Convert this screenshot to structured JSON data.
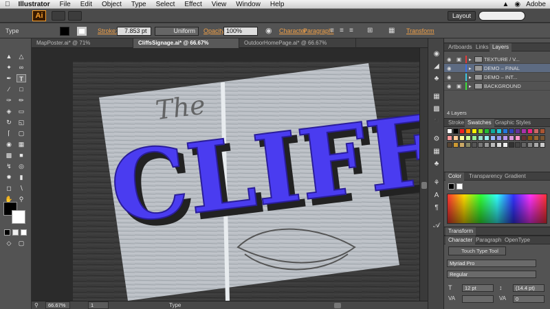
{
  "menubar": {
    "app": "Illustrator",
    "items": [
      "File",
      "Edit",
      "Object",
      "Type",
      "Select",
      "Effect",
      "View",
      "Window",
      "Help"
    ],
    "right_label": "Adobe"
  },
  "appbar": {
    "logo": "Ai",
    "workspace": "Layout"
  },
  "control": {
    "tool_label": "Type",
    "stroke_label": "Stroke:",
    "stroke_weight": "7.853 pt",
    "stroke_profile": "Uniform",
    "opacity_label": "Opacity:",
    "opacity_value": "100%",
    "character_link": "Character",
    "paragraph_link": "Paragraph:",
    "transform_link": "Transform"
  },
  "tabs": [
    {
      "label": "MapPoster.ai* @ 71% (CMYK/Preview)"
    },
    {
      "label": "CliffsSignage.ai* @ 66.67% (CMYK/Preview)"
    },
    {
      "label": "OutdoorHomePage.ai* @ 66.67% (RGB/Preview)"
    }
  ],
  "artwork": {
    "script_text": "The",
    "headline": "CLIFFS",
    "headline_color": "#4a3cf0"
  },
  "status": {
    "zoom": "66.67%",
    "page": "1",
    "tool": "Type"
  },
  "layers_panel": {
    "tabs": [
      "Artboards",
      "Links",
      "Layers"
    ],
    "layers": [
      {
        "name": "TEXTURE / V...",
        "color": "#e23c3c"
      },
      {
        "name": "DEMO – FINAL",
        "color": "#3c6ee2"
      },
      {
        "name": "DEMO – INT...",
        "color": "#3cc8e2"
      },
      {
        "name": "BACKGROUND",
        "color": "#3ce23c"
      }
    ],
    "count": "4 Layers"
  },
  "swatches_panel": {
    "tabs": [
      "Stroke",
      "Swatches",
      "Graphic Styles"
    ]
  },
  "color_panel": {
    "tabs": [
      "Color",
      "Transparency",
      "Gradient"
    ]
  },
  "transform_panel": {
    "title": "Transform"
  },
  "character_panel": {
    "tabs": [
      "Character",
      "Paragraph",
      "OpenType"
    ],
    "touch_type": "Touch Type Tool",
    "font_family": "Myriad Pro",
    "font_style": "Regular",
    "font_size": "12 pt",
    "leading": "(14.4 pt)",
    "tracking": "0"
  }
}
